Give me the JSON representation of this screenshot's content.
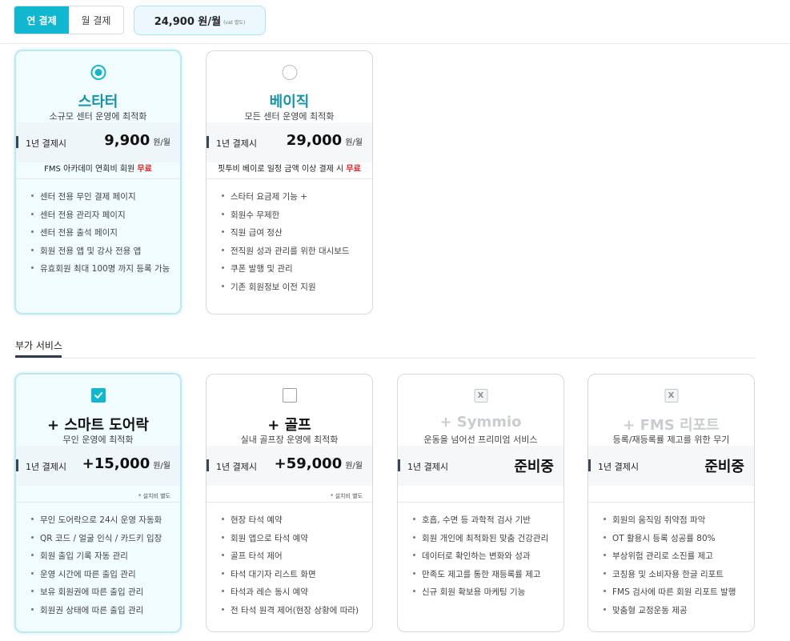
{
  "billing": {
    "tabs": [
      {
        "label": "연 결제",
        "active": true
      },
      {
        "label": "월 결제",
        "active": false
      }
    ],
    "total_amount": "24,900 원/월",
    "total_vat": "(vat 별도)"
  },
  "plans": [
    {
      "title": "스타터",
      "subtitle": "소규모 센터 운영에 최적화",
      "price_label": "1년 결제시",
      "price": "9,900",
      "unit": "원/월",
      "benefit": "FMS 아카데미 연회비 회원",
      "benefit_free": "무료",
      "selected": true,
      "features": [
        "센터 전용 무인 결제 페이지",
        "센터 전용 관리자 페이지",
        "센터 전용 출석 페이지",
        "회원 전용 앱 및 강사 전용 앱",
        "유효회원 최대 100명 까지 등록 가능"
      ]
    },
    {
      "title": "베이직",
      "subtitle": "모든 센터 운영에 최적화",
      "price_label": "1년 결제시",
      "price": "29,000",
      "unit": "원/월",
      "benefit": "핏투비 베이로 일정 금액 이상 결제 시",
      "benefit_free": "무료",
      "selected": false,
      "features": [
        "스타터 요금제 기능 +",
        "회원수 무제한",
        "직원 급여 정산",
        "전직원 성과 관리를 위한 대시보드",
        "쿠폰 발행 및 관리",
        "기존 회원정보 이전 지원"
      ]
    }
  ],
  "addons_section_title": "부가 서비스",
  "addons": [
    {
      "title": "+ 스마트 도어락",
      "subtitle": "무인 운영에 최적화",
      "price_label": "1년 결제시",
      "price": "+15,000",
      "unit": "원/월",
      "note": "* 설치비 별도",
      "state": "checked",
      "features": [
        "무인 도어락으로 24시 운영 자동화",
        "QR 코드 / 얼굴 인식 / 카드키 입장",
        "회원 출입 기록 자동 관리",
        "운영 시간에 따른 출입 관리",
        "보유 회원권에 따른 출입 관리",
        "회원권 상태에 따른 출입 관리"
      ]
    },
    {
      "title": "+ 골프",
      "subtitle": "실내 골프장 운영에 최적화",
      "price_label": "1년 결제시",
      "price": "+59,000",
      "unit": "원/월",
      "note": "* 설치비 별도",
      "state": "unchecked",
      "features": [
        "현장 타석 예약",
        "회원 앱으로 타석 예약",
        "골프 타석 제어",
        "타석 대기자 리스트 화면",
        "타석과 레슨 동시 예약",
        "전 타석 원격 제어(현장 상황에 따라)"
      ]
    },
    {
      "title": "+ Symmio",
      "subtitle": "운동을 넘어선 프리미엄 서비스",
      "price_label": "1년 결제시",
      "status": "준비중",
      "disabled_mark": "X",
      "state": "disabled",
      "features": [
        "호흡, 수면 등 과학적 검사 기반",
        "회원 개인에 최적화된 맞춤 건강관리",
        "데이터로 확인하는 변화와 성과",
        "만족도 제고를 통한 재등록률 제고",
        "신규 회원 확보용 마케팅 기능"
      ]
    },
    {
      "title": "+ FMS 리포트",
      "subtitle": "등록/재등록률 제고를 위한 무기",
      "price_label": "1년 결제시",
      "status": "준비중",
      "disabled_mark": "X",
      "state": "disabled",
      "features": [
        "회원의 움직임 취약점 파악",
        "OT 활용시 등록 성공률 80%",
        "부상위험 관리로 소진률 제고",
        "코칭용 및 소비자용 한글 리포트",
        "FMS 검사에 따른 회원 리포트 발행",
        "맞춤형 교정운동 제공"
      ]
    }
  ],
  "colors": {
    "accent": "#0fb8cf",
    "title_teal": "#1593a8",
    "free_red": "#e02020"
  }
}
